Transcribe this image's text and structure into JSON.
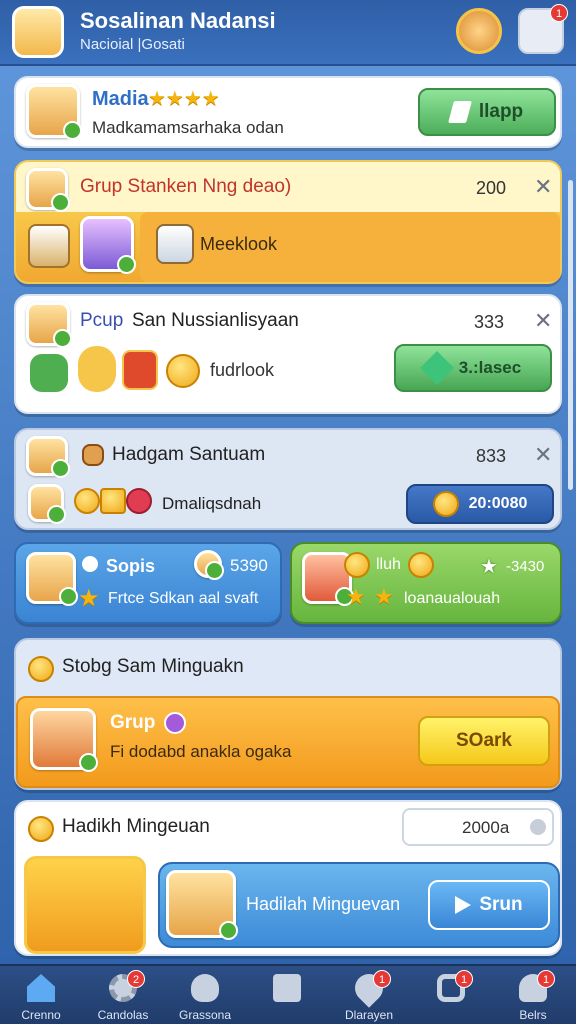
{
  "header": {
    "title": "Sosalinan Nadansi",
    "subtitle": "Nacioial |Gosati"
  },
  "cards": {
    "media": {
      "name": "Madia",
      "stars": "★★★★",
      "desc": "Madkamamsarhaka odan",
      "button": "llapp"
    },
    "grup": {
      "title": "Grup Stanken Nng deao)",
      "count": "200",
      "close": "✕",
      "item_label": "Meeklook"
    },
    "pcup": {
      "title_prefix": "Pcup",
      "title_rest": "San Nussianlisyaan",
      "count": "333",
      "close": "✕",
      "item_label": "fudrlook",
      "button": "3.:lasec"
    },
    "hadgam": {
      "title": "Hadgam Santuam",
      "count": "833",
      "close": "✕",
      "item_label": "Dmaliqsdnah",
      "button_value": "20:0080"
    },
    "sopis": {
      "name": "Sopis",
      "count": "5390",
      "desc": "Frtce Sdkan aal svaft"
    },
    "club": {
      "name": "lluh",
      "count": "-3430",
      "desc": "loanaualouah"
    },
    "weekly": {
      "title": "Stobg Sam Minguakn",
      "grup": "Grup",
      "desc": "Fi dodabd anakla ogaka",
      "button": "SOark"
    },
    "reward": {
      "title": "Hadikh Mingeuan",
      "input_value": "2000a",
      "banner": "Hadilah Minguevan",
      "button": "Srun"
    }
  },
  "nav": [
    {
      "label": "Crenno",
      "badge": ""
    },
    {
      "label": "Candolas",
      "badge": "2"
    },
    {
      "label": "Grassona",
      "badge": ""
    },
    {
      "label": "",
      "badge": ""
    },
    {
      "label": "Dlarayen",
      "badge": "1"
    },
    {
      "label": "",
      "badge": "1"
    },
    {
      "label": "Belrs",
      "badge": "1"
    }
  ],
  "header_badge": "1"
}
